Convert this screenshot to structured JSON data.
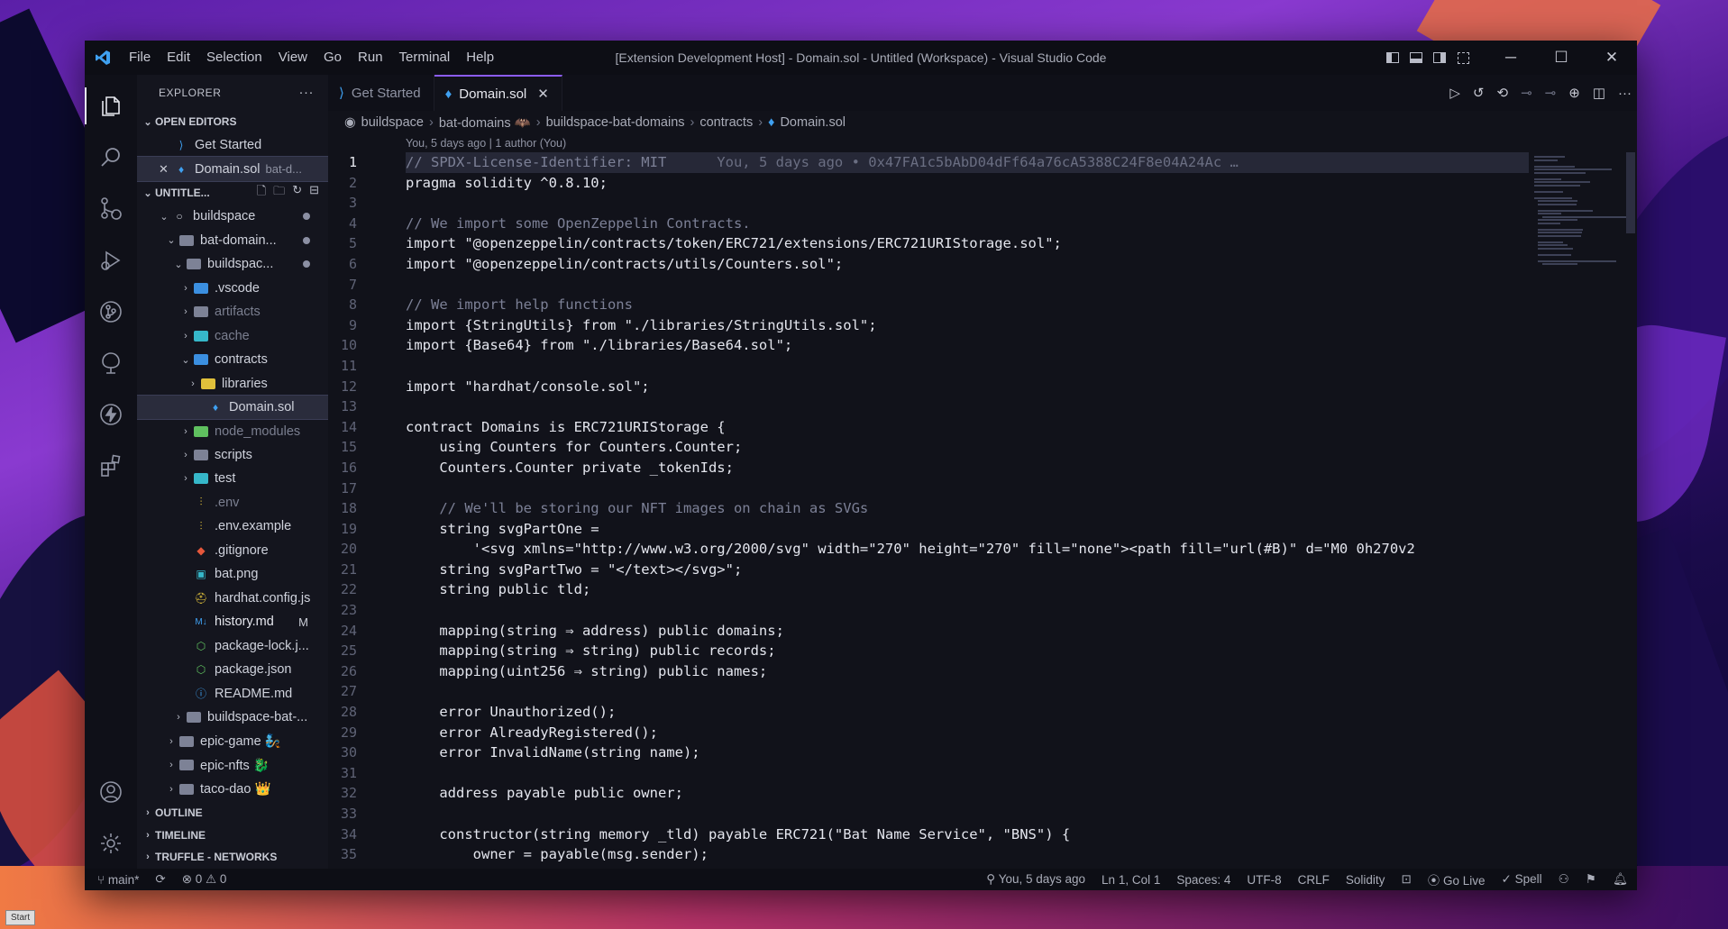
{
  "window": {
    "title": "[Extension Development Host] - Domain.sol - Untitled (Workspace) - Visual Studio Code",
    "menu": [
      "File",
      "Edit",
      "Selection",
      "View",
      "Go",
      "Run",
      "Terminal",
      "Help"
    ]
  },
  "taskbar": {
    "start": "Start"
  },
  "sidebar": {
    "header": "EXPLORER",
    "more": "···",
    "open_editors_title": "OPEN EDITORS",
    "open_editors": [
      {
        "label": "Get Started"
      },
      {
        "label": "Domain.sol",
        "desc": "bat-d..."
      }
    ],
    "workspace_title": "UNTITLE...",
    "tree": [
      {
        "label": "buildspace"
      },
      {
        "label": "bat-domain..."
      },
      {
        "label": "buildspac..."
      },
      {
        "label": ".vscode"
      },
      {
        "label": "artifacts"
      },
      {
        "label": "cache"
      },
      {
        "label": "contracts"
      },
      {
        "label": "libraries"
      },
      {
        "label": "Domain.sol"
      },
      {
        "label": "node_modules"
      },
      {
        "label": "scripts"
      },
      {
        "label": "test"
      },
      {
        "label": ".env"
      },
      {
        "label": ".env.example"
      },
      {
        "label": ".gitignore"
      },
      {
        "label": "bat.png"
      },
      {
        "label": "hardhat.config.js"
      },
      {
        "label": "history.md",
        "flag": "M"
      },
      {
        "label": "package-lock.j..."
      },
      {
        "label": "package.json"
      },
      {
        "label": "README.md"
      },
      {
        "label": "buildspace-bat-..."
      },
      {
        "label": "epic-game 🧞"
      },
      {
        "label": "epic-nfts 🐉"
      },
      {
        "label": "taco-dao 👑"
      }
    ],
    "outline": "OUTLINE",
    "timeline": "TIMELINE",
    "truffle": "TRUFFLE - NETWORKS"
  },
  "tabs": [
    {
      "label": "Get Started"
    },
    {
      "label": "Domain.sol"
    }
  ],
  "breadcrumb": [
    "buildspace",
    "bat-domains 🦇",
    "buildspace-bat-domains",
    "contracts",
    "Domain.sol"
  ],
  "blame": "You, 5 days ago | 1 author (You)",
  "code": {
    "line_numbers": [
      "1",
      "2",
      "3",
      "4",
      "5",
      "6",
      "7",
      "8",
      "9",
      "10",
      "11",
      "12",
      "13",
      "14",
      "15",
      "16",
      "17",
      "18",
      "19",
      "20",
      "21",
      "22",
      "23",
      "24",
      "25",
      "26",
      "27",
      "28",
      "29",
      "30",
      "31",
      "32",
      "33",
      "34",
      "35"
    ],
    "lines": [
      "// SPDX-License-Identifier: MIT",
      "pragma solidity ^0.8.10;",
      "",
      "// We import some OpenZeppelin Contracts.",
      "import \"@openzeppelin/contracts/token/ERC721/extensions/ERC721URIStorage.sol\";",
      "import \"@openzeppelin/contracts/utils/Counters.sol\";",
      "",
      "// We import help functions",
      "import {StringUtils} from \"./libraries/StringUtils.sol\";",
      "import {Base64} from \"./libraries/Base64.sol\";",
      "",
      "import \"hardhat/console.sol\";",
      "",
      "contract Domains is ERC721URIStorage {",
      "    using Counters for Counters.Counter;",
      "    Counters.Counter private _tokenIds;",
      "",
      "    // We'll be storing our NFT images on chain as SVGs",
      "    string svgPartOne =",
      "        '<svg xmlns=\"http://www.w3.org/2000/svg\" width=\"270\" height=\"270\" fill=\"none\"><path fill=\"url(#B)\" d=\"M0 0h270v2",
      "    string svgPartTwo = \"</text></svg>\";",
      "    string public tld;",
      "",
      "    mapping(string ⇒ address) public domains;",
      "    mapping(string ⇒ string) public records;",
      "    mapping(uint256 ⇒ string) public names;",
      "",
      "    error Unauthorized();",
      "    error AlreadyRegistered();",
      "    error InvalidName(string name);",
      "",
      "    address payable public owner;",
      "",
      "    constructor(string memory _tld) payable ERC721(\"Bat Name Service\", \"BNS\") {",
      "        owner = payable(msg.sender);"
    ],
    "inline_blame": "You, 5 days ago • 0x47FA1c5bAbD04dFf64a76cA5388C24F8e04A24Ac …"
  },
  "status": {
    "branch": "main*",
    "errors": "0",
    "warnings": "0",
    "blame": "You, 5 days ago",
    "position": "Ln 1, Col 1",
    "spaces": "Spaces: 4",
    "encoding": "UTF-8",
    "eol": "CRLF",
    "language": "Solidity",
    "golive": "Go Live",
    "spell": "Spell"
  },
  "colors": {
    "accent": "#8b5cf6",
    "keyword": "#e4e6ee",
    "comment": "#7c8096"
  }
}
